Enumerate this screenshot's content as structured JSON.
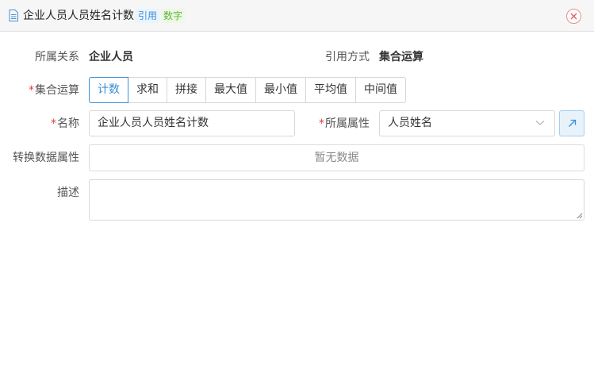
{
  "header": {
    "title": "企业人员人员姓名计数",
    "tag_ref": "引用",
    "tag_num": "数字",
    "colors": {
      "ref_tag": "#3c8ed6",
      "num_tag": "#5fb53c",
      "close": "#e05a5a"
    }
  },
  "form": {
    "belong_label": "所属关系",
    "belong_value": "企业人员",
    "ref_mode_label": "引用方式",
    "ref_mode_value": "集合运算",
    "agg_label": "集合运算",
    "agg_options": [
      "计数",
      "求和",
      "拼接",
      "最大值",
      "最小值",
      "平均值",
      "中间值"
    ],
    "agg_selected": "计数",
    "name_label": "名称",
    "name_value": "企业人员人员姓名计数",
    "attr_label": "所属属性",
    "attr_value": "人员姓名",
    "convert_label": "转换数据属性",
    "convert_empty": "暂无数据",
    "desc_label": "描述",
    "desc_value": "",
    "required_mark": "*"
  },
  "accent_color": "#3c8ed6",
  "icons": {
    "title": "document-icon",
    "close": "close-circle-icon",
    "select": "chevron-down-icon",
    "link": "arrow-up-right-icon"
  }
}
